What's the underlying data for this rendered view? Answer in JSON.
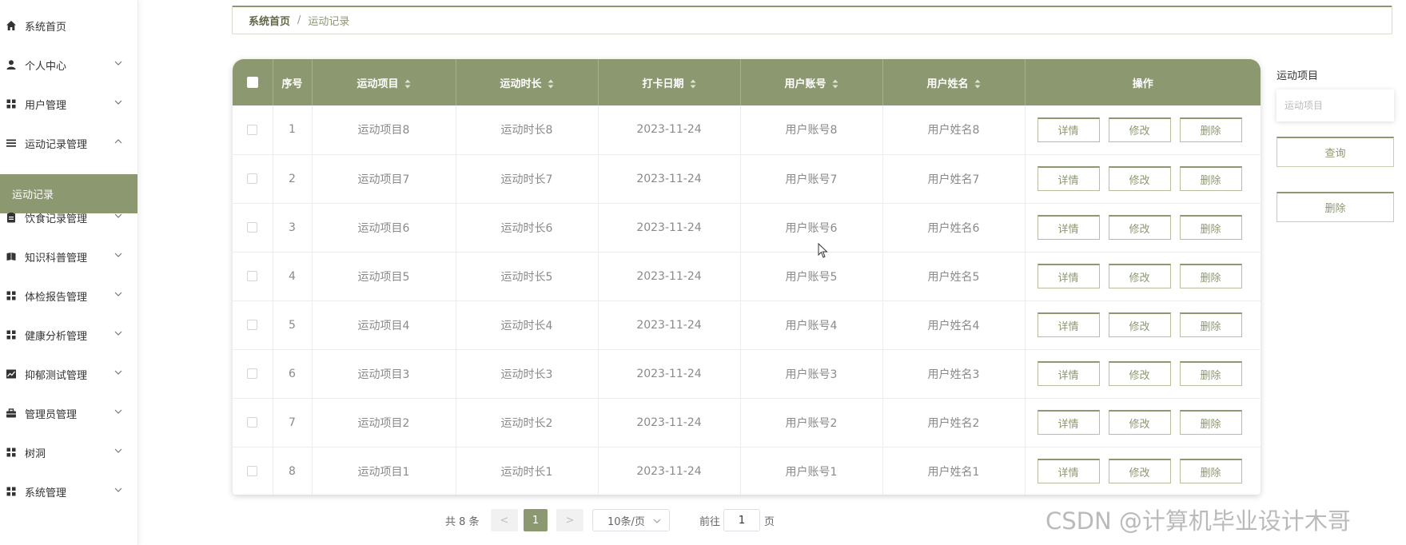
{
  "sidebar": {
    "items": [
      {
        "label": "系统首页",
        "icon": "home-icon"
      },
      {
        "label": "个人中心",
        "icon": "user-icon"
      },
      {
        "label": "用户管理",
        "icon": "grid-icon"
      },
      {
        "label": "运动记录管理",
        "icon": "list-icon"
      },
      {
        "label": "饮食记录管理",
        "icon": "clipboard-icon"
      },
      {
        "label": "知识科普管理",
        "icon": "book-icon"
      },
      {
        "label": "体检报告管理",
        "icon": "grid-icon"
      },
      {
        "label": "健康分析管理",
        "icon": "grid-icon"
      },
      {
        "label": "抑郁测试管理",
        "icon": "chart-icon"
      },
      {
        "label": "管理员管理",
        "icon": "briefcase-icon"
      },
      {
        "label": "树洞",
        "icon": "grid-icon"
      },
      {
        "label": "系统管理",
        "icon": "grid-icon"
      }
    ],
    "active_sub": "运动记录"
  },
  "breadcrumb": {
    "home": "系统首页",
    "separator": "/",
    "current": "运动记录"
  },
  "table": {
    "headers": [
      "序号",
      "运动项目",
      "运动时长",
      "打卡日期",
      "用户账号",
      "用户姓名",
      "操作"
    ],
    "rows": [
      {
        "no": "1",
        "item": "运动项目8",
        "duration": "运动时长8",
        "date": "2023-11-24",
        "account": "用户账号8",
        "name": "用户姓名8"
      },
      {
        "no": "2",
        "item": "运动项目7",
        "duration": "运动时长7",
        "date": "2023-11-24",
        "account": "用户账号7",
        "name": "用户姓名7"
      },
      {
        "no": "3",
        "item": "运动项目6",
        "duration": "运动时长6",
        "date": "2023-11-24",
        "account": "用户账号6",
        "name": "用户姓名6"
      },
      {
        "no": "4",
        "item": "运动项目5",
        "duration": "运动时长5",
        "date": "2023-11-24",
        "account": "用户账号5",
        "name": "用户姓名5"
      },
      {
        "no": "5",
        "item": "运动项目4",
        "duration": "运动时长4",
        "date": "2023-11-24",
        "account": "用户账号4",
        "name": "用户姓名4"
      },
      {
        "no": "6",
        "item": "运动项目3",
        "duration": "运动时长3",
        "date": "2023-11-24",
        "account": "用户账号3",
        "name": "用户姓名3"
      },
      {
        "no": "7",
        "item": "运动项目2",
        "duration": "运动时长2",
        "date": "2023-11-24",
        "account": "用户账号2",
        "name": "用户姓名2"
      },
      {
        "no": "8",
        "item": "运动项目1",
        "duration": "运动时长1",
        "date": "2023-11-24",
        "account": "用户账号1",
        "name": "用户姓名1"
      }
    ],
    "actions": {
      "detail": "详情",
      "edit": "修改",
      "delete": "删除"
    }
  },
  "search": {
    "label": "运动项目",
    "placeholder": "运动项目",
    "query_button": "查询",
    "delete_button": "删除"
  },
  "pagination": {
    "total": "共 8 条",
    "prev": "<",
    "current": "1",
    "next": ">",
    "page_size": "10条/页",
    "goto_label": "前往",
    "goto_value": "1",
    "page_unit": "页"
  },
  "watermark": "CSDN @计算机毕业设计木哥",
  "colors": {
    "accent": "#8c9870",
    "accent_dark": "#606748"
  }
}
